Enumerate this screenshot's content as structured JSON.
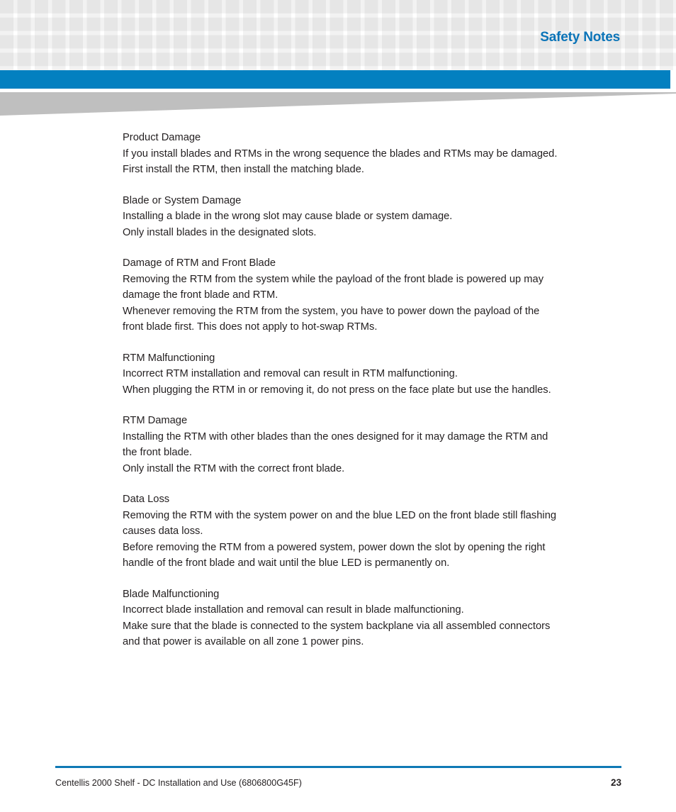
{
  "header": {
    "title": "Safety Notes",
    "accent_blue": "#0380c0",
    "title_color": "#0b74b8",
    "grid_square_color": "#f2f2f2",
    "wedge_color": "#bfbfbf"
  },
  "notes": [
    {
      "title": "Product Damage",
      "lines": [
        "If you install blades and RTMs in the wrong sequence the blades and RTMs may be damaged.",
        "First install the RTM, then install the matching blade."
      ]
    },
    {
      "title": "Blade or System Damage",
      "lines": [
        "Installing a blade in the wrong slot may cause blade or system damage.",
        "Only install blades in the designated slots."
      ]
    },
    {
      "title": "Damage of RTM and Front Blade",
      "lines": [
        "Removing the RTM from the system while the payload of the front blade is powered up may",
        "damage the front blade and RTM.",
        "Whenever removing the RTM from the system, you have to power down the payload of the",
        "front blade first. This does not apply to hot-swap RTMs."
      ]
    },
    {
      "title": "RTM Malfunctioning",
      "lines": [
        "Incorrect RTM installation and removal can result in RTM malfunctioning.",
        "When plugging the RTM in or removing it, do not press on the face plate but use the handles."
      ]
    },
    {
      "title": "RTM Damage",
      "lines": [
        "Installing the RTM with other blades than the ones designed for it may damage the RTM and",
        "the front blade.",
        "Only install the RTM with the correct front blade."
      ]
    },
    {
      "title": "Data Loss",
      "lines": [
        "Removing the RTM with the system power on and the blue LED on the front blade still flashing",
        "causes data loss.",
        "Before removing the RTM from a powered system, power down the slot by opening the right",
        "handle of the front blade and wait until the blue LED is permanently on."
      ]
    },
    {
      "title": "Blade Malfunctioning",
      "lines": [
        "Incorrect blade installation and removal can result in blade malfunctioning.",
        "Make sure that the blade is connected to the system backplane via all assembled connectors",
        "and that power is available on all zone 1 power pins."
      ]
    }
  ],
  "footer": {
    "document_title": "Centellis 2000 Shelf - DC Installation and Use (6806800G45F)",
    "page_number": "23",
    "rule_color": "#0f79b5"
  }
}
